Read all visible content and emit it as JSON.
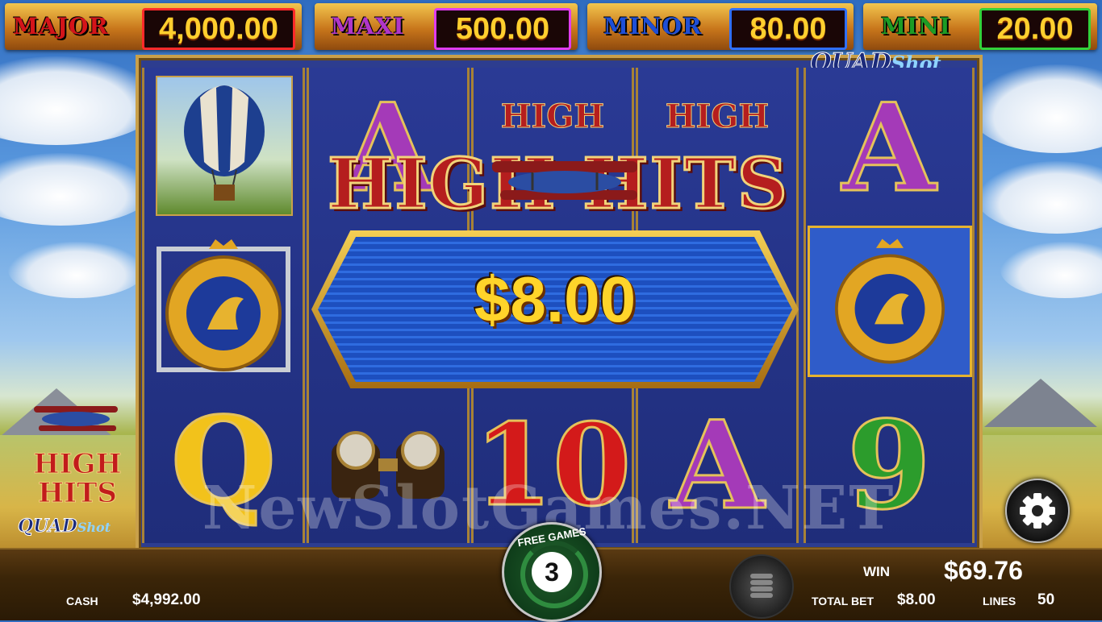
{
  "jackpots": [
    {
      "label": "MAJOR",
      "value": "4,000.00",
      "color": "#d4141a",
      "frame": "#ff2a2a"
    },
    {
      "label": "MAXI",
      "value": "500.00",
      "color": "#b036c9",
      "frame": "#e03cf0"
    },
    {
      "label": "MINOR",
      "value": "80.00",
      "color": "#1f4fd6",
      "frame": "#2f6fff"
    },
    {
      "label": "MINI",
      "value": "20.00",
      "color": "#1d9c25",
      "frame": "#33d13a"
    }
  ],
  "logo": {
    "quad": "QUAD",
    "shot": "Shot",
    "high": "HIGH",
    "hits": "HITS"
  },
  "banner": {
    "title": "HIGH HITS",
    "win_amount": "$8.00"
  },
  "reels": {
    "col1": {
      "top": "balloon",
      "mid": "eagle-crest",
      "bottom": "Q"
    },
    "col2": {
      "top": "A",
      "bottom": "binoculars"
    },
    "col3": {
      "top": "HIGH",
      "bottom": "10"
    },
    "col4": {
      "top": "HIGH",
      "bottom": "A"
    },
    "col5": {
      "top": "A",
      "mid": "eagle-crest",
      "bottom": "9"
    }
  },
  "free_games": {
    "label": "FREE GAMES",
    "count": "3"
  },
  "bottom": {
    "cash_label": "CASH",
    "cash_value": "$4,992.00",
    "win_label": "WIN",
    "win_value": "$69.76",
    "total_bet_label": "TOTAL BET",
    "total_bet_value": "$8.00",
    "lines_label": "LINES",
    "lines_value": "50"
  },
  "watermark": "NewSlotGames.NET",
  "icons": {
    "settings": "gear-icon",
    "spin": "coin-stack-icon"
  }
}
